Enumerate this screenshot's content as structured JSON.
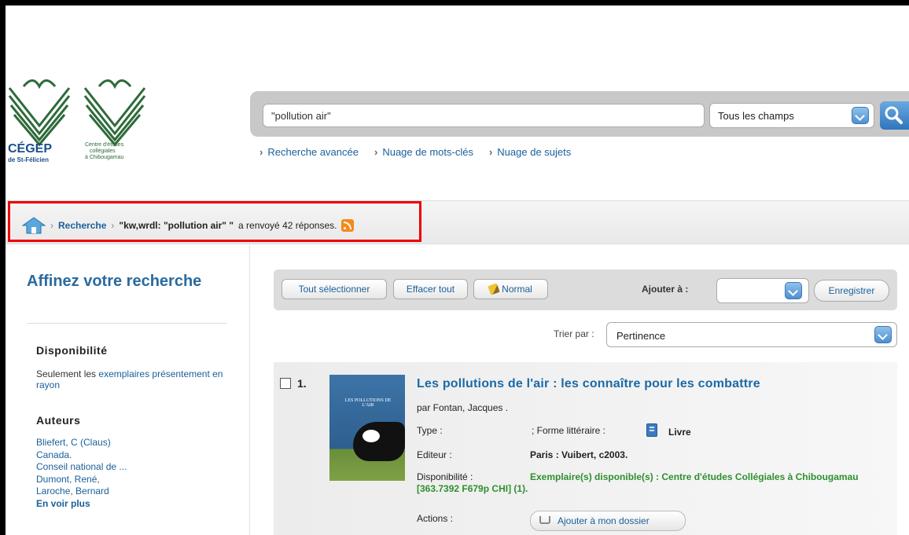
{
  "logos": {
    "cegep_line1": "CÉGEP",
    "cegep_line2": "de St-Félicien",
    "centre_line1": "Centre d'études",
    "centre_line2": "collégiales",
    "centre_line3": "à Chibougamau"
  },
  "search": {
    "value": "\"pollution air\"",
    "field_selected": "Tous les champs",
    "links": [
      "Recherche avancée",
      "Nuage de mots-clés",
      "Nuage de sujets"
    ]
  },
  "breadcrumb": {
    "link": "Recherche",
    "query": "\"kw,wrdl: \"pollution air\" \"",
    "result_text": "a renvoyé 42 réponses."
  },
  "facets": {
    "title": "Affinez votre recherche",
    "availability_heading": "Disponibilité",
    "availability_text": "Seulement les",
    "availability_link": "exemplaires présentement en rayon",
    "authors_heading": "Auteurs",
    "authors": [
      "Bliefert, C (Claus)",
      "Canada.",
      "Conseil national de ...",
      "Dumont, René,",
      "Laroche, Bernard"
    ],
    "more": "En voir plus"
  },
  "toolbar": {
    "select_all": "Tout sélectionner",
    "clear_all": "Effacer tout",
    "normal": "Normal",
    "add_to_label": "Ajouter à :",
    "save": "Enregistrer"
  },
  "sort": {
    "label": "Trier par :",
    "selected": "Pertinence"
  },
  "result": {
    "number": "1.",
    "cover_title": "LES POLLUTIONS DE L'AIR",
    "title": "Les pollutions de l'air : les connaître pour les combattre",
    "author": "par Fontan, Jacques .",
    "type_label": "Type :",
    "form_label": "; Forme littéraire :",
    "type_value": "Livre",
    "editor_label": "Editeur :",
    "editor_value": "Paris : Vuibert, c2003.",
    "avail_label": "Disponibilité :",
    "avail_value": "Exemplaire(s) disponible(s) : Centre d'études Collégiales à Chibougamau [363.7392 F679p CHI] (1).",
    "actions_label": "Actions :",
    "add_dossier": "Ajouter à mon dossier"
  }
}
